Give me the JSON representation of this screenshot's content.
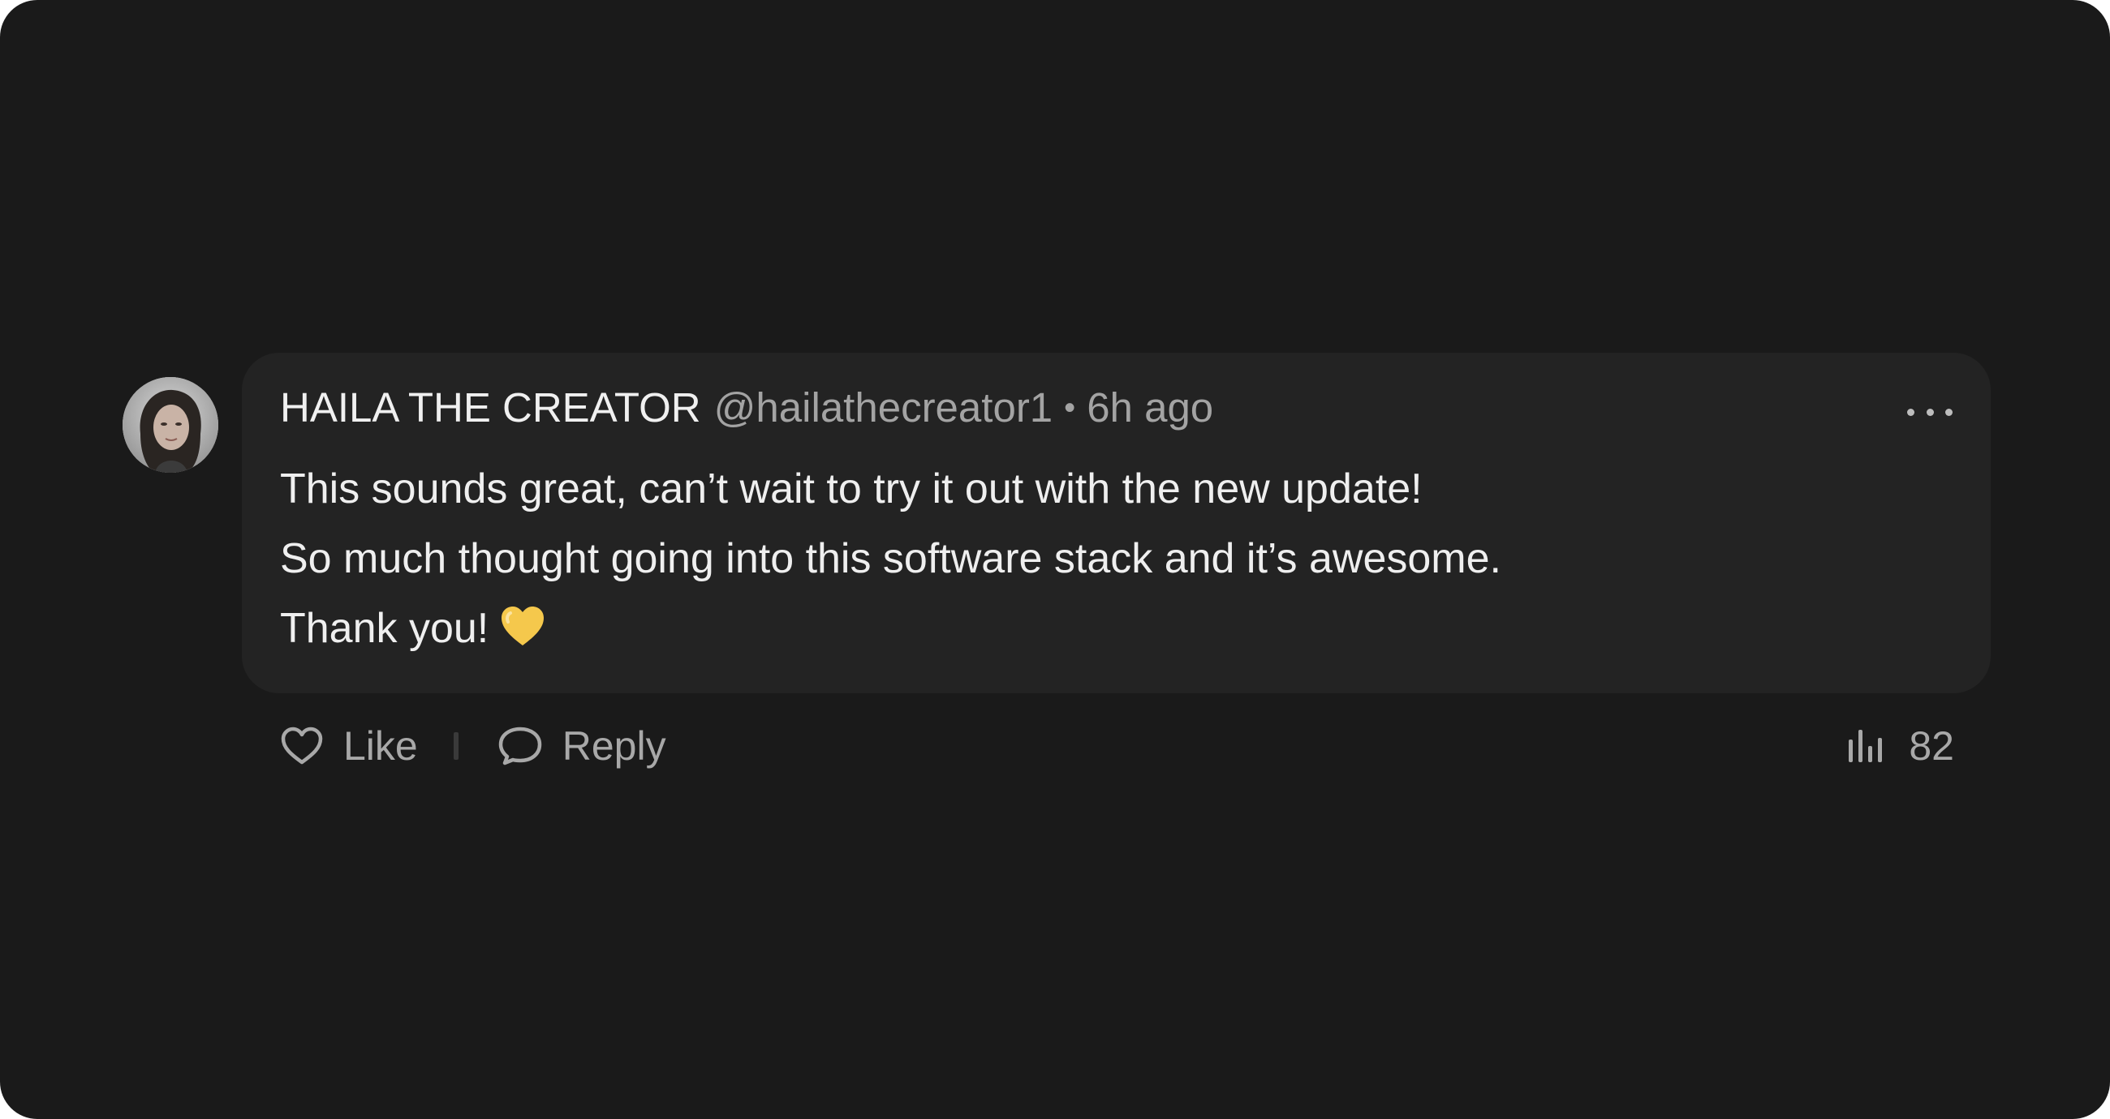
{
  "comment": {
    "author": "HAILA THE CREATOR",
    "handle": "@hailathecreator1",
    "separator": "•",
    "time": "6h ago",
    "lines": [
      "This sounds great, can’t wait to try it out with the new update!",
      "So much thought going into this software stack and it’s awesome.",
      "Thank you!"
    ],
    "emoji": "yellow-heart-icon"
  },
  "actions": {
    "like_label": "Like",
    "reply_label": "Reply",
    "views_count": "82"
  },
  "icons": {
    "more": "more-horizontal-icon",
    "like": "heart-outline-icon",
    "reply": "chat-bubble-icon",
    "views": "bar-chart-icon"
  },
  "colors": {
    "background": "#1a1a1a",
    "bubble": "#232323",
    "text_primary": "#efefef",
    "text_secondary": "#a3a3a3",
    "emoji_heart": "#f5c84c"
  }
}
